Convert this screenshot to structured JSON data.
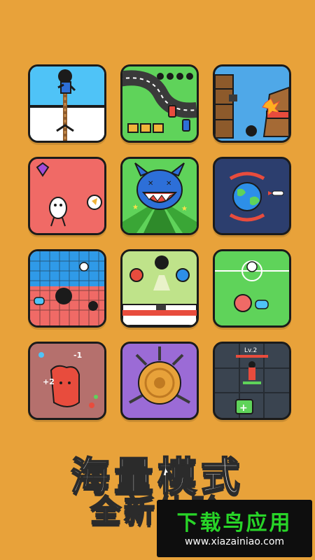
{
  "tiles": [
    {
      "name": "rope-climb"
    },
    {
      "name": "race-track"
    },
    {
      "name": "ship-cannon"
    },
    {
      "name": "gem-runner"
    },
    {
      "name": "monster-smash"
    },
    {
      "name": "planet-defense"
    },
    {
      "name": "grid-shooter"
    },
    {
      "name": "knight-battle"
    },
    {
      "name": "soccer"
    },
    {
      "name": "blob-eater",
      "labels": {
        "minus": "-1",
        "plus": "+2"
      }
    },
    {
      "name": "knife-hit"
    },
    {
      "name": "tower-level",
      "labels": {
        "level": "Lv.2"
      }
    }
  ],
  "headline": {
    "line1": "海量模式",
    "line2": "全新体验"
  },
  "watermark": {
    "title": "下载鸟应用",
    "url": "www.xiazainiao.com"
  }
}
